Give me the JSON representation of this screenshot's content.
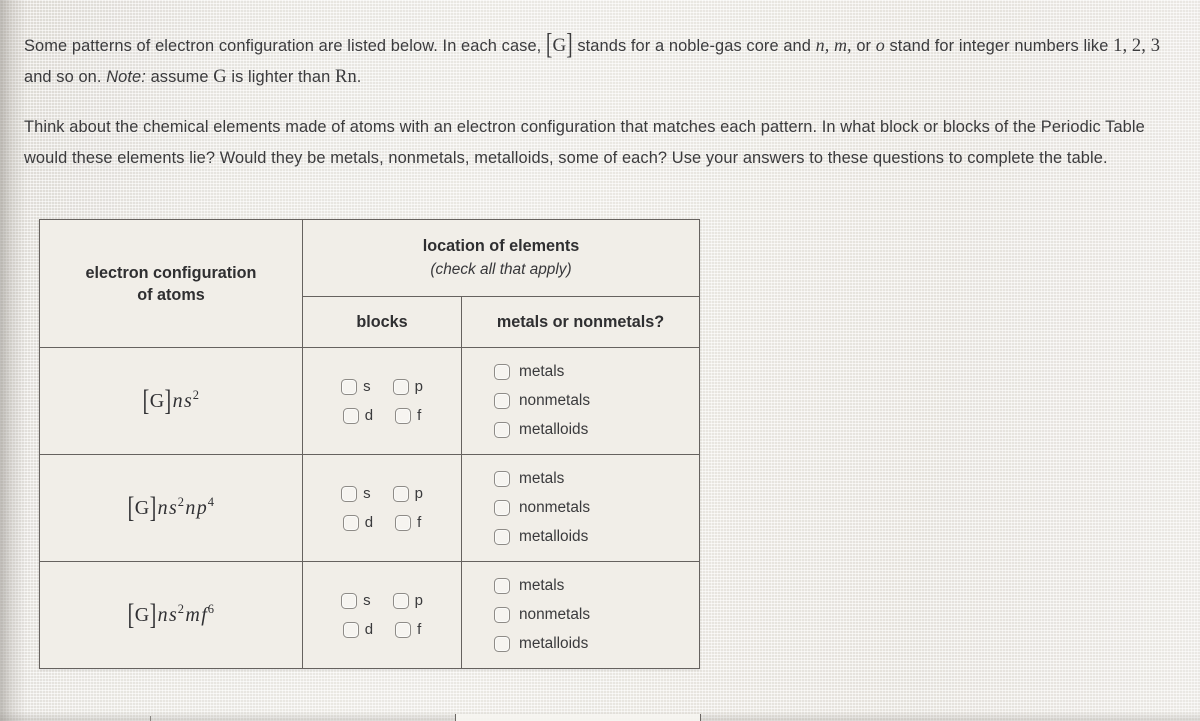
{
  "problem": {
    "paragraph_1_part_1": "Some patterns of electron configuration are listed below. In each case,",
    "paragraph_1_core_symbol": "G",
    "paragraph_1_part_2": "stands for a noble-gas core and",
    "paragraph_1_vars": "n, m,",
    "paragraph_1_or": "or",
    "paragraph_1_var_o": "o",
    "paragraph_1_part_3": "stand for integer numbers like",
    "paragraph_1_numbers": "1, 2, 3",
    "paragraph_1_part_4": "and so on.",
    "paragraph_1_note_label": "Note:",
    "paragraph_1_note_text_1": "assume",
    "paragraph_1_note_symbol": "G",
    "paragraph_1_note_text_2": "is lighter than",
    "paragraph_1_note_rn": "Rn",
    "paragraph_1_note_period": ".",
    "paragraph_2": "Think about the chemical elements made of atoms with an electron configuration that matches each pattern. In what block or blocks of the Periodic Table would these elements lie? Would they be metals, nonmetals, metalloids, some of each? Use your answers to these questions to complete the table."
  },
  "table": {
    "headers": {
      "col_config": "electron configuration of atoms",
      "col_config_line1": "electron configuration",
      "col_config_line2": "of atoms",
      "group_location": "location of elements",
      "group_location_sub": "(check all that apply)",
      "col_blocks": "blocks",
      "col_metals": "metals or nonmetals?"
    },
    "block_options": [
      "s",
      "p",
      "d",
      "f"
    ],
    "metal_options": [
      "metals",
      "nonmetals",
      "metalloids"
    ],
    "rows": [
      {
        "config": {
          "core": "G",
          "terms": [
            {
              "base_var": "n",
              "orbital": "s",
              "exponent": "2"
            }
          ],
          "plain": "[G]ns2"
        },
        "blocks_checked": [],
        "metals_checked": []
      },
      {
        "config": {
          "core": "G",
          "terms": [
            {
              "base_var": "n",
              "orbital": "s",
              "exponent": "2"
            },
            {
              "base_var": "n",
              "orbital": "p",
              "exponent": "4"
            }
          ],
          "plain": "[G]ns2np4"
        },
        "blocks_checked": [],
        "metals_checked": []
      },
      {
        "config": {
          "core": "G",
          "terms": [
            {
              "base_var": "n",
              "orbital": "s",
              "exponent": "2"
            },
            {
              "base_var": "m",
              "orbital": "f",
              "exponent": "6"
            }
          ],
          "plain": "[G]ns2mf6"
        },
        "blocks_checked": [],
        "metals_checked": []
      }
    ]
  },
  "colors": {
    "paper": "#efece6",
    "text": "#3b3b3d",
    "table_border": "#66625f",
    "checkbox_border": "#8e8b87"
  }
}
